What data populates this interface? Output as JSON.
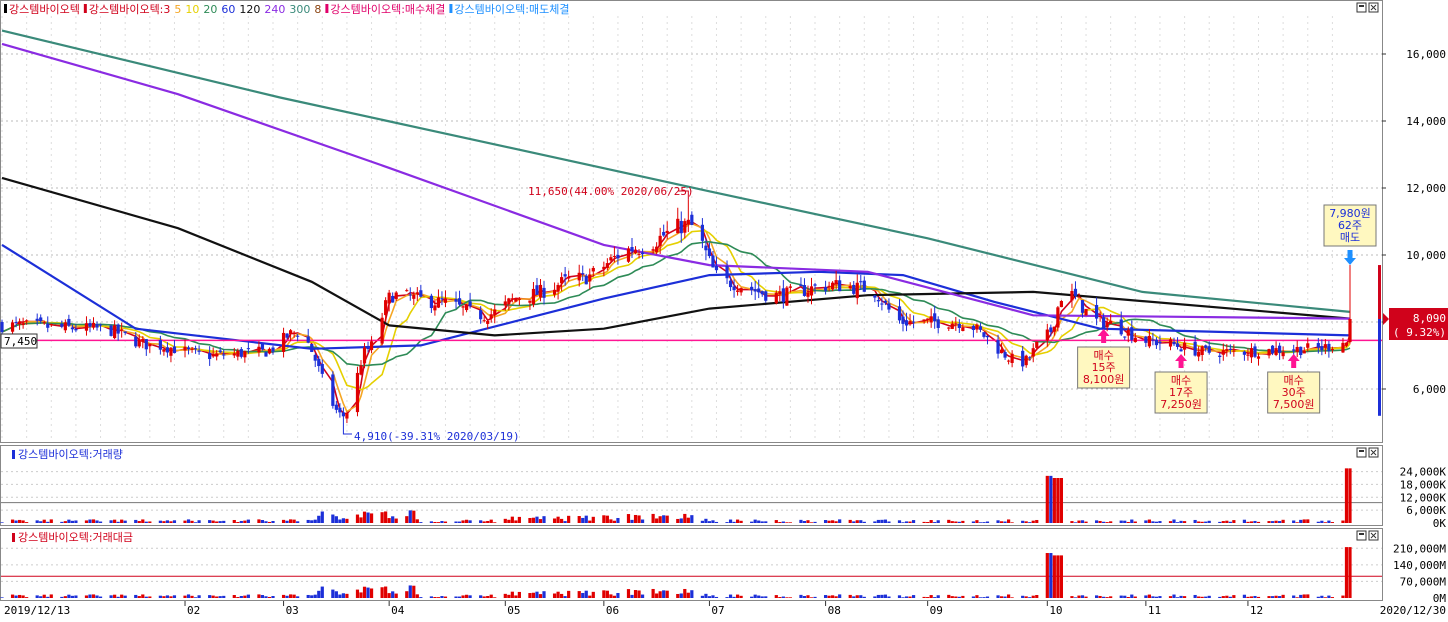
{
  "legend": {
    "items": [
      {
        "text": "강스템바이오텍",
        "color": "#d0021b"
      },
      {
        "text": "강스템바이오텍:3",
        "color": "#d0021b"
      },
      {
        "text": "5",
        "color": "#f5a623"
      },
      {
        "text": "10",
        "color": "#e5d000"
      },
      {
        "text": "20",
        "color": "#2e8b57"
      },
      {
        "text": "60",
        "color": "#1c2fd8"
      },
      {
        "text": "120",
        "color": "#111111"
      },
      {
        "text": "240",
        "color": "#8a2be2"
      },
      {
        "text": "300",
        "color": "#3a8a7a"
      },
      {
        "text": "8",
        "color": "#8b4513"
      },
      {
        "text": "강스템바이오텍:매수체결",
        "color": "#e0006a"
      },
      {
        "text": "강스템바이오텍:매도체결",
        "color": "#1e90ff"
      }
    ]
  },
  "panels": {
    "price_y_ticks": [
      "16,000",
      "14,000",
      "12,000",
      "10,000",
      "8,000",
      "6,000"
    ],
    "current_price": "8,090",
    "current_change": "( 9.32%)",
    "left_price_label": "7,450",
    "high_annotation": "11,650(44.00% 2020/06/25)",
    "low_annotation": "4,910(-39.31% 2020/03/19)",
    "volume_title": "강스템바이오텍:거래량",
    "volume_y_ticks": [
      "24,000K",
      "18,000K",
      "12,000K",
      "6,000K",
      "0K"
    ],
    "amount_title": "강스템바이오텍:거래대금",
    "amount_y_ticks": [
      "210,000M",
      "140,000M",
      "70,000M",
      "0M"
    ]
  },
  "trades": [
    {
      "kind": "buy",
      "lines": [
        "매수",
        "15주",
        "8,100원"
      ],
      "date": "2020/10/21",
      "price": 7750
    },
    {
      "kind": "buy",
      "lines": [
        "매수",
        "17주",
        "7,250원"
      ],
      "date": "2020/11/12",
      "price": 7100
    },
    {
      "kind": "buy",
      "lines": [
        "매수",
        "30주",
        "7,500원"
      ],
      "date": "2020/12/14",
      "price": 7150
    },
    {
      "kind": "sell",
      "lines": [
        "7,980원",
        "62주",
        "매도"
      ],
      "date": "2020/12/30",
      "price": 9700
    }
  ],
  "x_axis": {
    "labels": [
      "2019/12/13",
      "02",
      "03",
      "04",
      "05",
      "06",
      "07",
      "08",
      "09",
      "10",
      "11",
      "12",
      "2020/12/30"
    ]
  },
  "chart_data": {
    "type": "candlestick",
    "x_range": [
      "2019/12/13",
      "2020/12/30"
    ],
    "price_ylim": [
      5000,
      17500
    ],
    "price_anchors": [
      {
        "date": "2019/12/13",
        "close": 7900
      },
      {
        "date": "2020/01/10",
        "close": 7800
      },
      {
        "date": "2020/01/25",
        "close": 7300
      },
      {
        "date": "2020/02/10",
        "close": 7000
      },
      {
        "date": "2020/02/25",
        "close": 7100
      },
      {
        "date": "2020/03/06",
        "close": 7700
      },
      {
        "date": "2020/03/19",
        "close": 5200
      },
      {
        "date": "2020/03/26",
        "close": 7200
      },
      {
        "date": "2020/04/02",
        "close": 8800
      },
      {
        "date": "2020/04/15",
        "close": 8600
      },
      {
        "date": "2020/04/28",
        "close": 8200
      },
      {
        "date": "2020/05/10",
        "close": 8800
      },
      {
        "date": "2020/05/25",
        "close": 9300
      },
      {
        "date": "2020/06/10",
        "close": 10200
      },
      {
        "date": "2020/06/25",
        "close": 10900
      },
      {
        "date": "2020/07/05",
        "close": 9200
      },
      {
        "date": "2020/07/20",
        "close": 8800
      },
      {
        "date": "2020/08/05",
        "close": 9100
      },
      {
        "date": "2020/08/15",
        "close": 9000
      },
      {
        "date": "2020/08/25",
        "close": 8000
      },
      {
        "date": "2020/09/10",
        "close": 8000
      },
      {
        "date": "2020/09/28",
        "close": 6800
      },
      {
        "date": "2020/10/05",
        "close": 7600
      },
      {
        "date": "2020/10/10",
        "close": 8900
      },
      {
        "date": "2020/10/20",
        "close": 8000
      },
      {
        "date": "2020/11/05",
        "close": 7400
      },
      {
        "date": "2020/11/20",
        "close": 7100
      },
      {
        "date": "2020/12/20",
        "close": 7200
      },
      {
        "date": "2020/12/29",
        "close": 7400
      },
      {
        "date": "2020/12/30",
        "close": 8090
      }
    ],
    "moving_averages": [
      {
        "name": "60",
        "color": "#1c2fd8",
        "points": [
          [
            "2019/12/13",
            10300
          ],
          [
            "2020/01/20",
            7800
          ],
          [
            "2020/03/10",
            7200
          ],
          [
            "2020/04/10",
            7300
          ],
          [
            "2020/06/01",
            8700
          ],
          [
            "2020/07/01",
            9400
          ],
          [
            "2020/08/01",
            9500
          ],
          [
            "2020/08/25",
            9400
          ],
          [
            "2020/09/20",
            8600
          ],
          [
            "2020/10/20",
            7800
          ],
          [
            "2020/12/30",
            7600
          ]
        ]
      },
      {
        "name": "120",
        "color": "#111111",
        "points": [
          [
            "2019/12/13",
            12300
          ],
          [
            "2020/02/01",
            10800
          ],
          [
            "2020/03/10",
            9200
          ],
          [
            "2020/04/01",
            7900
          ],
          [
            "2020/05/01",
            7600
          ],
          [
            "2020/06/01",
            7800
          ],
          [
            "2020/07/01",
            8400
          ],
          [
            "2020/08/15",
            8800
          ],
          [
            "2020/10/01",
            8900
          ],
          [
            "2020/12/30",
            8100
          ]
        ]
      },
      {
        "name": "240",
        "color": "#8a2be2",
        "points": [
          [
            "2019/12/13",
            16300
          ],
          [
            "2020/02/01",
            14800
          ],
          [
            "2020/04/01",
            12600
          ],
          [
            "2020/06/01",
            10300
          ],
          [
            "2020/07/01",
            9700
          ],
          [
            "2020/08/15",
            9500
          ],
          [
            "2020/10/01",
            8200
          ],
          [
            "2020/12/30",
            8100
          ]
        ]
      },
      {
        "name": "300",
        "color": "#3a8a7a",
        "points": [
          [
            "2019/12/13",
            16700
          ],
          [
            "2020/03/01",
            14700
          ],
          [
            "2020/07/01",
            11900
          ],
          [
            "2020/09/01",
            10500
          ],
          [
            "2020/11/01",
            8900
          ],
          [
            "2020/12/30",
            8300
          ]
        ]
      }
    ],
    "horizontal_line": {
      "price": 7450,
      "color": "#ff1493"
    },
    "high": {
      "date": "2020/06/25",
      "price": 11650
    },
    "low": {
      "date": "2020/03/19",
      "price": 4910
    },
    "volume_ylim": [
      0,
      28000
    ],
    "volume_spikes": [
      {
        "date": "2020/10/05",
        "value": 22000
      },
      {
        "date": "2020/10/08",
        "value": 21000
      },
      {
        "date": "2020/12/30",
        "value": 25500
      }
    ],
    "amount_ylim": [
      0,
      245000
    ],
    "amount_spikes": [
      {
        "date": "2020/10/05",
        "value": 190000
      },
      {
        "date": "2020/10/08",
        "value": 180000
      },
      {
        "date": "2020/12/30",
        "value": 215000
      }
    ]
  }
}
